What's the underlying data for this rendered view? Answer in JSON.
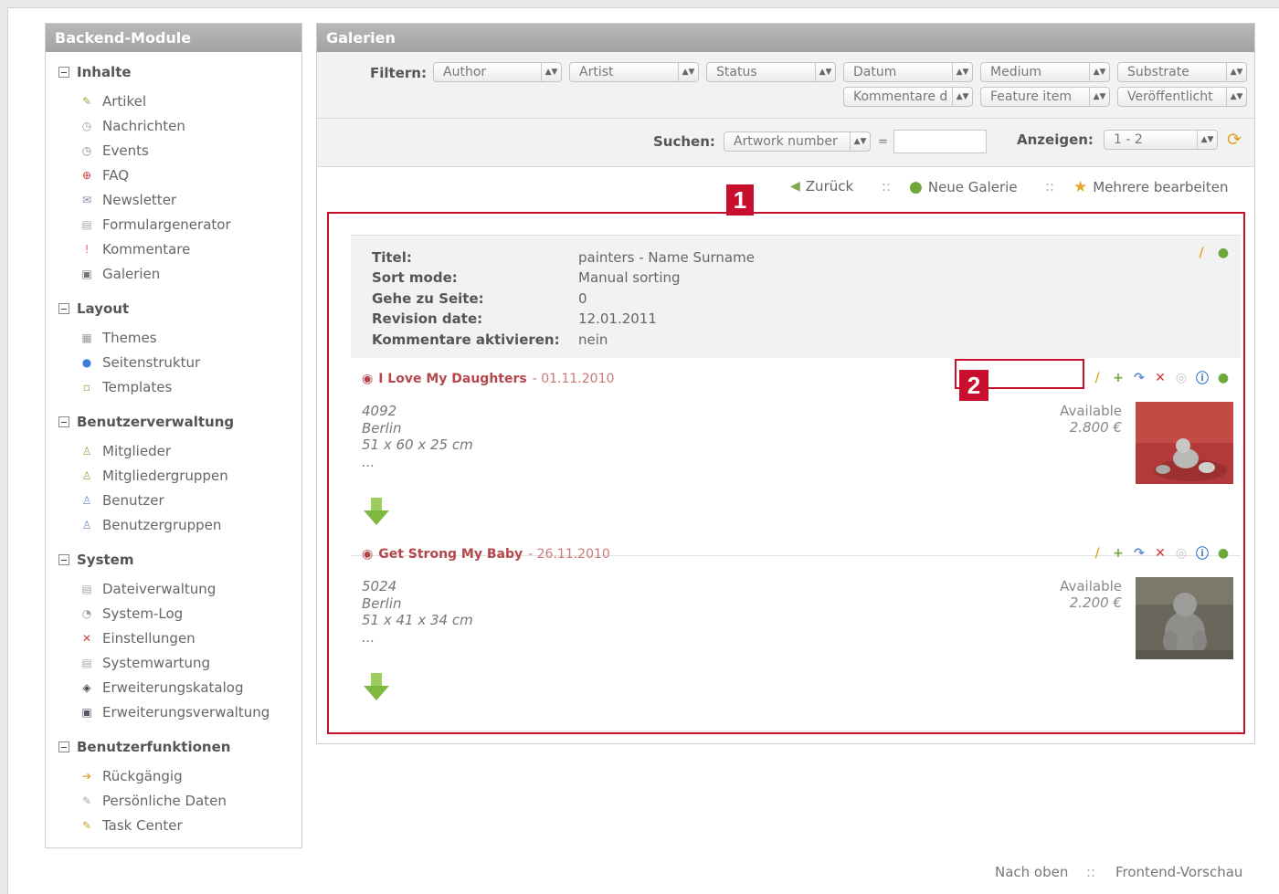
{
  "sidebar": {
    "title": "Backend-Module",
    "groups": [
      {
        "label": "Inhalte",
        "items": [
          {
            "label": "Artikel",
            "icon": "article-icon"
          },
          {
            "label": "Nachrichten",
            "icon": "news-icon"
          },
          {
            "label": "Events",
            "icon": "calendar-icon"
          },
          {
            "label": "FAQ",
            "icon": "faq-icon"
          },
          {
            "label": "Newsletter",
            "icon": "newsletter-icon"
          },
          {
            "label": "Formulargenerator",
            "icon": "form-icon"
          },
          {
            "label": "Kommentare",
            "icon": "comments-icon"
          },
          {
            "label": "Galerien",
            "icon": "gallery-icon"
          }
        ]
      },
      {
        "label": "Layout",
        "items": [
          {
            "label": "Themes",
            "icon": "themes-icon"
          },
          {
            "label": "Seitenstruktur",
            "icon": "globe-icon"
          },
          {
            "label": "Templates",
            "icon": "template-icon"
          }
        ]
      },
      {
        "label": "Benutzerverwaltung",
        "items": [
          {
            "label": "Mitglieder",
            "icon": "member-icon"
          },
          {
            "label": "Mitgliedergruppen",
            "icon": "member-group-icon"
          },
          {
            "label": "Benutzer",
            "icon": "user-icon"
          },
          {
            "label": "Benutzergruppen",
            "icon": "user-group-icon"
          }
        ]
      },
      {
        "label": "System",
        "items": [
          {
            "label": "Dateiverwaltung",
            "icon": "files-icon"
          },
          {
            "label": "System-Log",
            "icon": "log-icon"
          },
          {
            "label": "Einstellungen",
            "icon": "settings-icon"
          },
          {
            "label": "Systemwartung",
            "icon": "maintenance-icon"
          },
          {
            "label": "Erweiterungskatalog",
            "icon": "catalog-icon"
          },
          {
            "label": "Erweiterungsverwaltung",
            "icon": "extension-icon"
          }
        ]
      },
      {
        "label": "Benutzerfunktionen",
        "items": [
          {
            "label": "Rückgängig",
            "icon": "undo-icon"
          },
          {
            "label": "Persönliche Daten",
            "icon": "personal-data-icon"
          },
          {
            "label": "Task Center",
            "icon": "task-icon"
          }
        ]
      }
    ]
  },
  "main": {
    "title": "Galerien",
    "filter_label": "Filtern:",
    "filters": [
      "Author",
      "Artist",
      "Status",
      "Datum",
      "Medium",
      "Substrate",
      "Kommentare d",
      "Feature item",
      "Veröffentlicht"
    ],
    "search_label": "Suchen:",
    "search_field": "Artwork number",
    "search_equals": "=",
    "search_value": "",
    "show_label": "Anzeigen:",
    "show_value": "1 - 2",
    "actions": {
      "back": "Zurück",
      "new": "Neue Galerie",
      "multi": "Mehrere bearbeiten",
      "sep": "::"
    },
    "meta": [
      {
        "key": "Titel:",
        "value": "painters - Name Surname"
      },
      {
        "key": "Sort mode:",
        "value": "Manual sorting"
      },
      {
        "key": "Gehe zu Seite:",
        "value": "0"
      },
      {
        "key": "Revision date:",
        "value": "12.01.2011"
      },
      {
        "key": "Kommentare aktivieren:",
        "value": "nein"
      }
    ],
    "items": [
      {
        "title": "I Love My Daughters",
        "date": " - 01.11.2010",
        "number": "4092",
        "city": "Berlin",
        "size": "51 x 60 x 25 cm",
        "more": "...",
        "status": "Available",
        "price": "2.800 €"
      },
      {
        "title": "Get Strong My Baby",
        "date": " - 26.11.2010",
        "number": "5024",
        "city": "Berlin",
        "size": "51 x 41 x 34 cm",
        "more": "...",
        "status": "Available",
        "price": "2.200 €"
      }
    ]
  },
  "annotations": {
    "one": "1",
    "two": "2"
  },
  "footer": {
    "top": "Nach oben",
    "sep": "::",
    "preview": "Frontend-Vorschau"
  },
  "colors": {
    "accent_red": "#c8102e",
    "header_gray": "#a8a8a8",
    "title_red": "#b5474c"
  }
}
